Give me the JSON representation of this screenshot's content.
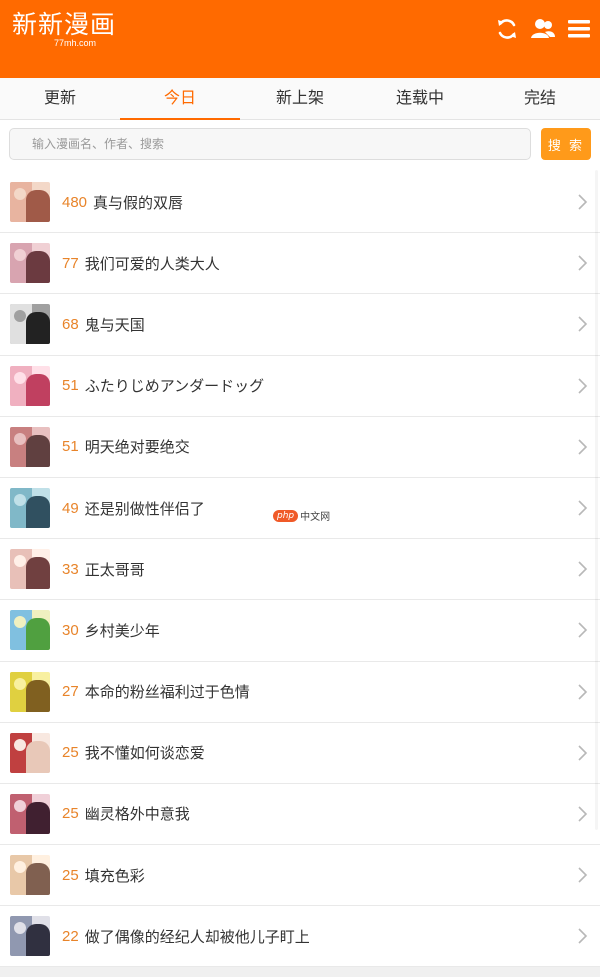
{
  "header": {
    "logo_title": "新新漫画",
    "logo_sub": "77mh.com",
    "icons": [
      "refresh-icon",
      "user-icon",
      "menu-icon"
    ],
    "accent": "#ff6a00"
  },
  "tabs": [
    {
      "label": "更新",
      "active": false
    },
    {
      "label": "今日",
      "active": true
    },
    {
      "label": "新上架",
      "active": false
    },
    {
      "label": "连载中",
      "active": false
    },
    {
      "label": "完结",
      "active": false
    }
  ],
  "search": {
    "placeholder": "输入漫画名、作者、搜索",
    "button_label": "搜 索"
  },
  "items": [
    {
      "count": "480",
      "title": "真与假的双唇"
    },
    {
      "count": "77",
      "title": "我们可爱的人类大人"
    },
    {
      "count": "68",
      "title": "鬼与天国"
    },
    {
      "count": "51",
      "title": "ふたりじめアンダードッグ"
    },
    {
      "count": "51",
      "title": "明天绝对要绝交"
    },
    {
      "count": "49",
      "title": "还是别做性伴侣了"
    },
    {
      "count": "33",
      "title": "正太哥哥"
    },
    {
      "count": "30",
      "title": "乡村美少年"
    },
    {
      "count": "27",
      "title": "本命的粉丝福利过于色情"
    },
    {
      "count": "25",
      "title": "我不懂如何谈恋爱"
    },
    {
      "count": "25",
      "title": "幽灵格外中意我"
    },
    {
      "count": "25",
      "title": "填充色彩"
    },
    {
      "count": "22",
      "title": "做了偶像的经纪人却被他儿子盯上"
    }
  ],
  "watermark": {
    "logo": "php",
    "text": "中文网"
  }
}
